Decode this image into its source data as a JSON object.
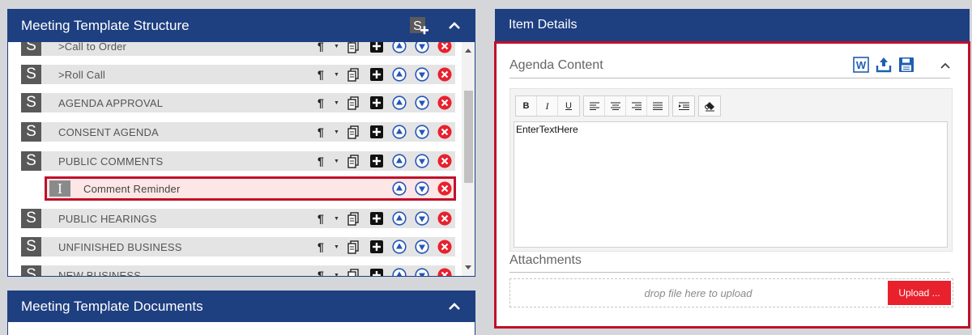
{
  "structure_panel": {
    "title": "Meeting Template Structure",
    "badge_letter": "S",
    "sections": [
      {
        "label": ">Call to Order"
      },
      {
        "label": ">Roll Call"
      },
      {
        "label": "AGENDA APPROVAL"
      },
      {
        "label": "CONSENT AGENDA"
      },
      {
        "label": "PUBLIC COMMENTS"
      },
      {
        "label": "PUBLIC HEARINGS"
      },
      {
        "label": "UNFINISHED BUSINESS"
      },
      {
        "label": "NEW BUSINESS"
      }
    ],
    "selected_item": {
      "badge_letter": "I",
      "label": "Comment Reminder"
    },
    "format_symbol": "¶",
    "colors": {
      "header": "#1e3f80",
      "delete": "#e8212d",
      "move": "#2456b8",
      "selected_border": "#c0102a"
    }
  },
  "documents_panel": {
    "title": "Meeting Template Documents"
  },
  "details_panel": {
    "title": "Item Details",
    "agenda_content_title": "Agenda Content",
    "editor_text": "EnterTextHere",
    "toolbar": {
      "bold": "B",
      "italic": "I",
      "underline": "U"
    },
    "attachments_title": "Attachments",
    "dropzone_text": "drop file here to upload",
    "upload_label": "Upload ..."
  }
}
